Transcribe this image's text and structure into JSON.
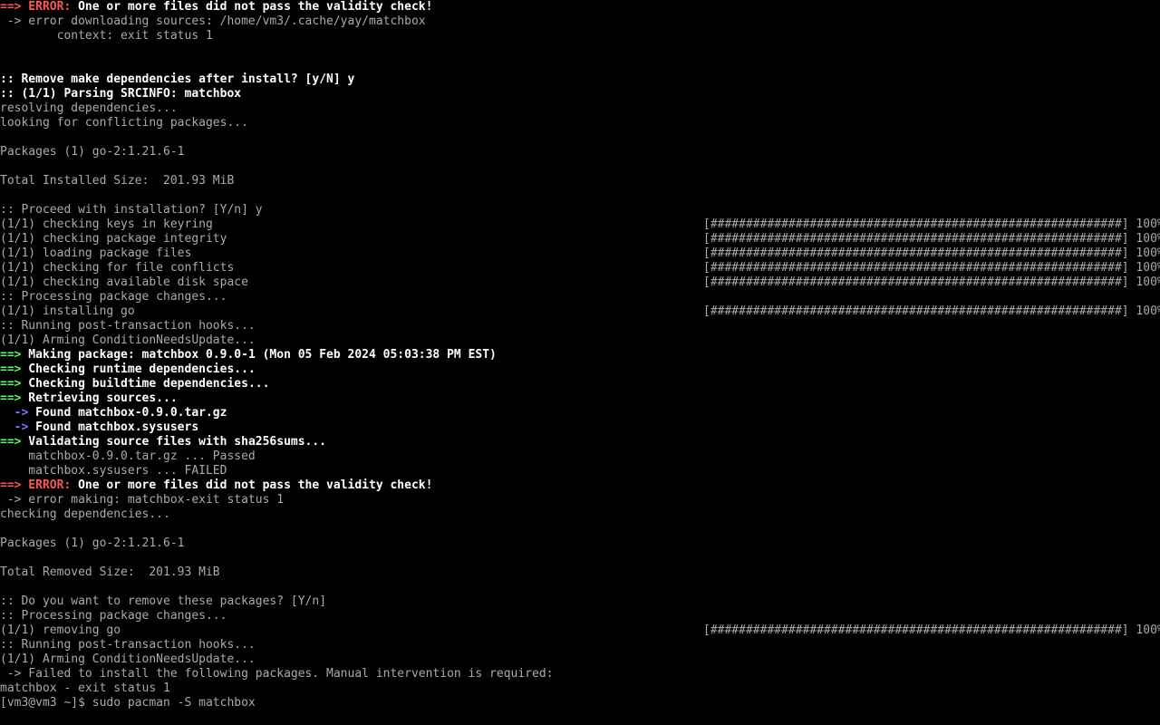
{
  "terminal": {
    "lines": [
      {
        "parts": [
          {
            "t": "==>",
            "c": "red"
          },
          {
            "t": " ERROR:",
            "c": "red"
          },
          {
            "t": " One or more files did not pass the validity check!",
            "c": "bright"
          }
        ]
      },
      {
        "parts": [
          {
            "t": " -> error downloading sources: /home/vm3/.cache/yay/matchbox",
            "c": "gray"
          }
        ]
      },
      {
        "parts": [
          {
            "t": "        context: exit status 1",
            "c": "gray"
          }
        ]
      },
      {
        "parts": []
      },
      {
        "parts": []
      },
      {
        "parts": [
          {
            "t": ":: Remove make dependencies after install? [y/N] y",
            "c": "bright"
          }
        ]
      },
      {
        "parts": [
          {
            "t": ":: ",
            "c": "bright"
          },
          {
            "t": "(1/1) Parsing SRCINFO: matchbox",
            "c": "bright"
          }
        ]
      },
      {
        "parts": [
          {
            "t": "resolving dependencies...",
            "c": "gray"
          }
        ]
      },
      {
        "parts": [
          {
            "t": "looking for conflicting packages...",
            "c": "gray"
          }
        ]
      },
      {
        "parts": []
      },
      {
        "parts": [
          {
            "t": "Packages (1) go-2:1.21.6-1",
            "c": "gray"
          }
        ]
      },
      {
        "parts": []
      },
      {
        "parts": [
          {
            "t": "Total Installed Size:  201.93 MiB",
            "c": "gray"
          }
        ]
      },
      {
        "parts": []
      },
      {
        "parts": [
          {
            "t": ":: Proceed with installation? [Y/n] y",
            "c": "gray"
          }
        ]
      },
      {
        "parts": [
          {
            "t": "(1/1) checking keys in keyring",
            "c": "gray"
          }
        ],
        "bar": "[##########################################################] 100%"
      },
      {
        "parts": [
          {
            "t": "(1/1) checking package integrity",
            "c": "gray"
          }
        ],
        "bar": "[##########################################################] 100%"
      },
      {
        "parts": [
          {
            "t": "(1/1) loading package files",
            "c": "gray"
          }
        ],
        "bar": "[##########################################################] 100%"
      },
      {
        "parts": [
          {
            "t": "(1/1) checking for file conflicts",
            "c": "gray"
          }
        ],
        "bar": "[##########################################################] 100%"
      },
      {
        "parts": [
          {
            "t": "(1/1) checking available disk space",
            "c": "gray"
          }
        ],
        "bar": "[##########################################################] 100%"
      },
      {
        "parts": [
          {
            "t": ":: Processing package changes...",
            "c": "gray"
          }
        ]
      },
      {
        "parts": [
          {
            "t": "(1/1) installing go",
            "c": "gray"
          }
        ],
        "bar": "[##########################################################] 100%"
      },
      {
        "parts": [
          {
            "t": ":: Running post-transaction hooks...",
            "c": "gray"
          }
        ]
      },
      {
        "parts": [
          {
            "t": "(1/1) Arming ConditionNeedsUpdate...",
            "c": "gray"
          }
        ]
      },
      {
        "parts": [
          {
            "t": "==>",
            "c": "green"
          },
          {
            "t": " Making package: matchbox 0.9.0-1 (Mon 05 Feb 2024 05:03:38 PM EST)",
            "c": "bright"
          }
        ]
      },
      {
        "parts": [
          {
            "t": "==>",
            "c": "green"
          },
          {
            "t": " Checking runtime dependencies...",
            "c": "bright"
          }
        ]
      },
      {
        "parts": [
          {
            "t": "==>",
            "c": "green"
          },
          {
            "t": " Checking buildtime dependencies...",
            "c": "bright"
          }
        ]
      },
      {
        "parts": [
          {
            "t": "==>",
            "c": "green"
          },
          {
            "t": " Retrieving sources...",
            "c": "bright"
          }
        ]
      },
      {
        "parts": [
          {
            "t": "  ->",
            "c": "blue"
          },
          {
            "t": " Found matchbox-0.9.0.tar.gz",
            "c": "bright"
          }
        ]
      },
      {
        "parts": [
          {
            "t": "  ->",
            "c": "blue"
          },
          {
            "t": " Found matchbox.sysusers",
            "c": "bright"
          }
        ]
      },
      {
        "parts": [
          {
            "t": "==>",
            "c": "green"
          },
          {
            "t": " Validating source files with sha256sums...",
            "c": "bright"
          }
        ]
      },
      {
        "parts": [
          {
            "t": "    matchbox-0.9.0.tar.gz ... Passed",
            "c": "gray"
          }
        ]
      },
      {
        "parts": [
          {
            "t": "    matchbox.sysusers ... FAILED",
            "c": "gray"
          }
        ]
      },
      {
        "parts": [
          {
            "t": "==>",
            "c": "red"
          },
          {
            "t": " ERROR:",
            "c": "red"
          },
          {
            "t": " One or more files did not pass the validity check!",
            "c": "bright"
          }
        ]
      },
      {
        "parts": [
          {
            "t": " -> error making: matchbox-exit status 1",
            "c": "gray"
          }
        ]
      },
      {
        "parts": [
          {
            "t": "checking dependencies...",
            "c": "gray"
          }
        ]
      },
      {
        "parts": []
      },
      {
        "parts": [
          {
            "t": "Packages (1) go-2:1.21.6-1",
            "c": "gray"
          }
        ]
      },
      {
        "parts": []
      },
      {
        "parts": [
          {
            "t": "Total Removed Size:  201.93 MiB",
            "c": "gray"
          }
        ]
      },
      {
        "parts": []
      },
      {
        "parts": [
          {
            "t": ":: Do you want to remove these packages? [Y/n]",
            "c": "gray"
          }
        ]
      },
      {
        "parts": [
          {
            "t": ":: Processing package changes...",
            "c": "gray"
          }
        ]
      },
      {
        "parts": [
          {
            "t": "(1/1) removing go",
            "c": "gray"
          }
        ],
        "bar": "[##########################################################] 100%"
      },
      {
        "parts": [
          {
            "t": ":: Running post-transaction hooks...",
            "c": "gray"
          }
        ]
      },
      {
        "parts": [
          {
            "t": "(1/1) Arming ConditionNeedsUpdate...",
            "c": "gray"
          }
        ]
      },
      {
        "parts": [
          {
            "t": " -> Failed to install the following packages. Manual intervention is required:",
            "c": "gray"
          }
        ]
      },
      {
        "parts": [
          {
            "t": "matchbox - exit status 1",
            "c": "gray"
          }
        ]
      },
      {
        "parts": [
          {
            "t": "[vm3@vm3 ~]$ sudo pacman -S matchbox",
            "c": "gray"
          }
        ],
        "prompt": true
      }
    ]
  }
}
